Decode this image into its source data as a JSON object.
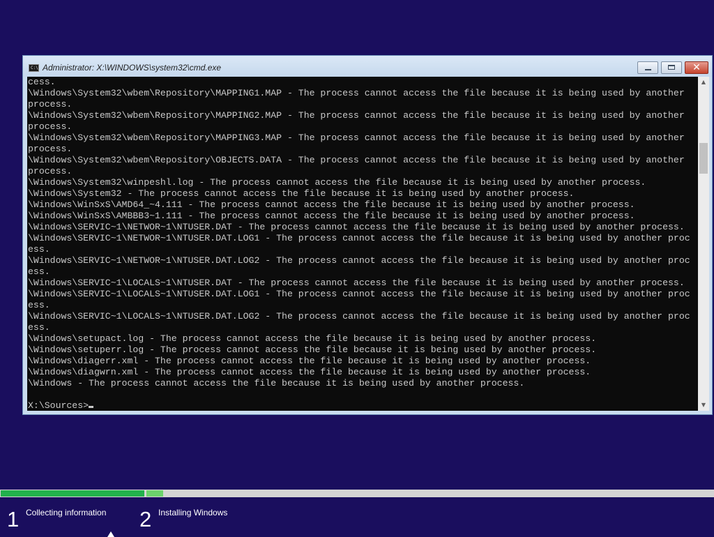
{
  "window": {
    "title": "Administrator: X:\\WINDOWS\\system32\\cmd.exe",
    "icon": "console-icon",
    "icon_text": "C:\\",
    "controls": {
      "minimize": "minimize",
      "maximize": "maximize",
      "close": "✕"
    }
  },
  "console": {
    "lines": [
      "cess.",
      "\\Windows\\System32\\wbem\\Repository\\MAPPING1.MAP - The process cannot access the file because it is being used by another",
      "process.",
      "\\Windows\\System32\\wbem\\Repository\\MAPPING2.MAP - The process cannot access the file because it is being used by another",
      "process.",
      "\\Windows\\System32\\wbem\\Repository\\MAPPING3.MAP - The process cannot access the file because it is being used by another",
      "process.",
      "\\Windows\\System32\\wbem\\Repository\\OBJECTS.DATA - The process cannot access the file because it is being used by another",
      "process.",
      "\\Windows\\System32\\winpeshl.log - The process cannot access the file because it is being used by another process.",
      "\\Windows\\System32 - The process cannot access the file because it is being used by another process.",
      "\\Windows\\WinSxS\\AMD64_~4.111 - The process cannot access the file because it is being used by another process.",
      "\\Windows\\WinSxS\\AMBBB3~1.111 - The process cannot access the file because it is being used by another process.",
      "\\Windows\\SERVIC~1\\NETWOR~1\\NTUSER.DAT - The process cannot access the file because it is being used by another process.",
      "\\Windows\\SERVIC~1\\NETWOR~1\\NTUSER.DAT.LOG1 - The process cannot access the file because it is being used by another proc",
      "ess.",
      "\\Windows\\SERVIC~1\\NETWOR~1\\NTUSER.DAT.LOG2 - The process cannot access the file because it is being used by another proc",
      "ess.",
      "\\Windows\\SERVIC~1\\LOCALS~1\\NTUSER.DAT - The process cannot access the file because it is being used by another process.",
      "\\Windows\\SERVIC~1\\LOCALS~1\\NTUSER.DAT.LOG1 - The process cannot access the file because it is being used by another proc",
      "ess.",
      "\\Windows\\SERVIC~1\\LOCALS~1\\NTUSER.DAT.LOG2 - The process cannot access the file because it is being used by another proc",
      "ess.",
      "\\Windows\\setupact.log - The process cannot access the file because it is being used by another process.",
      "\\Windows\\setuperr.log - The process cannot access the file because it is being used by another process.",
      "\\Windows\\diagerr.xml - The process cannot access the file because it is being used by another process.",
      "\\Windows\\diagwrn.xml - The process cannot access the file because it is being used by another process.",
      "\\Windows - The process cannot access the file because it is being used by another process.",
      ""
    ],
    "prompt": "X:\\Sources>"
  },
  "scrollbar": {
    "up": "▲",
    "down": "▼"
  },
  "setup": {
    "progress": {
      "collecting_fraction": 1.0,
      "installing_fraction": 0.03
    },
    "steps": [
      {
        "number": "1",
        "label": "Collecting information"
      },
      {
        "number": "2",
        "label": "Installing Windows"
      }
    ]
  },
  "colors": {
    "desktop_bg": "#1a0e5e",
    "progress_done": "#22b14c",
    "progress_active": "#6cd36c",
    "console_bg": "#0c0c0c",
    "console_fg": "#c8c8c8"
  }
}
